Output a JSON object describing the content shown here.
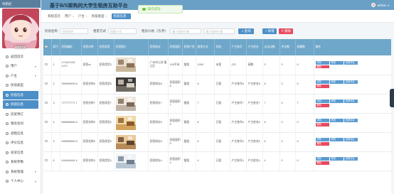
{
  "sidebar": {
    "top_label": "导航栏",
    "username": "admin",
    "items": [
      {
        "label": "返回首页",
        "active": false,
        "arrow": false
      },
      {
        "label": "用户",
        "active": false,
        "arrow": true
      },
      {
        "label": "户主",
        "active": false,
        "arrow": true
      },
      {
        "label": "民宿类型",
        "active": false,
        "arrow": false
      },
      {
        "label": "民宿信息",
        "active": true,
        "arrow": false
      },
      {
        "label": "民宿信息",
        "active": true,
        "arrow": false
      },
      {
        "label": "房屋预订",
        "active": false,
        "arrow": false
      },
      {
        "label": "租房合同",
        "active": false,
        "arrow": false
      },
      {
        "label": "退租信息",
        "active": false,
        "arrow": false
      },
      {
        "label": "评价信息",
        "active": false,
        "arrow": false
      },
      {
        "label": "投诉信息",
        "active": false,
        "arrow": false
      },
      {
        "label": "系统参数",
        "active": false,
        "arrow": false
      },
      {
        "label": "系统管理",
        "active": false,
        "arrow": true
      },
      {
        "label": "个人中心",
        "active": false,
        "arrow": true
      }
    ]
  },
  "header": {
    "title": "基于B/S架构的大学生租房互助平台",
    "toast": "操作成功",
    "user": "admin"
  },
  "tags": [
    {
      "label": "系统首页",
      "current": false
    },
    {
      "label": "用户",
      "current": false
    },
    {
      "label": "户主",
      "current": false
    },
    {
      "label": "民宿类型",
      "current": false
    },
    {
      "label": "民宿信息",
      "current": true
    }
  ],
  "search": {
    "label1": "民宿名称",
    "placeholder1": "民宿名称",
    "label2": "租客方式",
    "placeholder2": "租客方式",
    "label3": "租房价格（元/月）",
    "placeholder3": "最小租房价格",
    "placeholder4": "最大租房价格",
    "search_btn": "查询",
    "add_btn": "新增",
    "del_btn": "删除"
  },
  "table": {
    "headers": [
      "",
      "索引",
      "民宿编码",
      "民宿名称",
      "民宿类型",
      "民宿图片",
      "民宿地址",
      "民宿面积",
      "民宿户型",
      "租赁方式",
      "状态",
      "户主账号",
      "户主姓名",
      "点击次数",
      "评论数",
      "收藏数",
      "操作"
    ],
    "rows": [
      {
        "idx": "1",
        "code": "171167416 1471",
        "name": "民宿xx",
        "type": "民宿类型3",
        "img": 0,
        "addr": "广州市江苏 镇江区",
        "area": "100平米",
        "layout": "整租",
        "rent": "1000",
        "status": "未租",
        "owner_acc": "222",
        "owner_name": "高鹏",
        "clicks": "3",
        "comments": "0",
        "favs": "0"
      },
      {
        "idx": "2",
        "code": "999999999 8",
        "name": "民宿名称8",
        "type": "民宿类型8",
        "img": 1,
        "addr": "民宿地址8",
        "area": "民宿面积8",
        "layout": "整租",
        "rent": "8",
        "status": "已租",
        "owner_acc": "户主账号8",
        "owner_name": "户主姓名8",
        "clicks": "8",
        "comments": "0",
        "favs": "0"
      },
      {
        "idx": "3",
        "code": "777777777 7",
        "name": "民宿名称7",
        "type": "民宿类型7",
        "img": 2,
        "addr": "民宿地址7",
        "area": "民宿面积7",
        "layout": "整租",
        "rent": "7",
        "status": "已租",
        "owner_acc": "户主账号7",
        "owner_name": "户主姓名7",
        "clicks": "7",
        "comments": "0",
        "favs": "7"
      },
      {
        "idx": "4",
        "code": "666666666 6",
        "name": "民宿名称6",
        "type": "民宿类型6",
        "img": 3,
        "addr": "民宿地址6",
        "area": "民宿面积6",
        "layout": "整租",
        "rent": "6",
        "status": "已租",
        "owner_acc": "户主账号6",
        "owner_name": "户主姓名6",
        "clicks": "6",
        "comments": "0",
        "favs": "0"
      },
      {
        "idx": "5",
        "code": "555555555 5",
        "name": "民宿名称5",
        "type": "民宿类型5",
        "img": 4,
        "addr": "民宿地址5",
        "area": "民宿面积5",
        "layout": "整租",
        "rent": "5",
        "status": "已租",
        "owner_acc": "户主账号5",
        "owner_name": "户主姓名5",
        "clicks": "5",
        "comments": "0",
        "favs": "0"
      },
      {
        "idx": "6",
        "code": "444444444 4",
        "name": "民宿名称4",
        "type": "民宿类型4",
        "img": 5,
        "addr": "民宿地址4",
        "area": "民宿面积4",
        "layout": "整租",
        "rent": "4",
        "status": "已租",
        "owner_acc": "户主账号4",
        "owner_name": "户主姓名4",
        "clicks": "4",
        "comments": "0",
        "favs": "0"
      }
    ],
    "ops": {
      "view": "详情",
      "edit": "修改",
      "eval": "查看评论",
      "del": "删除"
    }
  },
  "colors": {
    "accent": "#4d8fc7",
    "header": "#6ba0c6",
    "danger": "#e84a5f"
  }
}
